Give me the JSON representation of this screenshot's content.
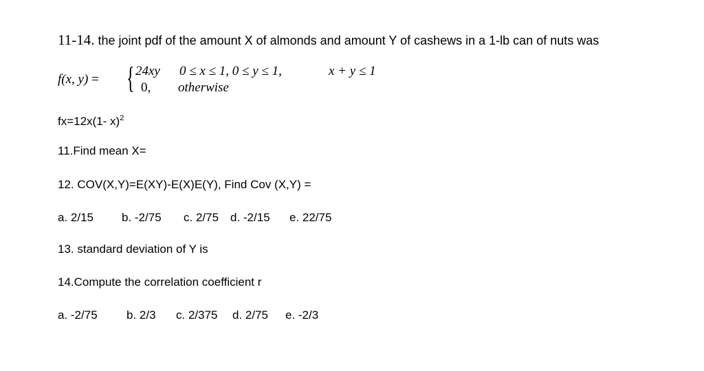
{
  "problem": {
    "number": "11-14.",
    "intro": " the joint pdf of the amount X of almonds and amount Y of cashews in a 1-lb can of nuts was"
  },
  "formula": {
    "lhs": "f(x, y)",
    "equals": " =",
    "brace": "{",
    "case1_expr": "24xy",
    "case1_condition": "0 ≤ x ≤ 1, 0 ≤ y ≤ 1,",
    "case1_extra": "x + y ≤ 1",
    "case2_expr": "0,",
    "case2_condition": "otherwise"
  },
  "marginal": {
    "text": "fx=12x(1- x)",
    "exponent": "2"
  },
  "questions": [
    {
      "id": "q11",
      "text": "11.Find mean X="
    },
    {
      "id": "q12",
      "text": "12. COV(X,Y)=E(XY)-E(X)E(Y), Find Cov (X,Y) ="
    },
    {
      "id": "q13",
      "text": "13. standard deviation of Y is"
    },
    {
      "id": "q14",
      "text": "14.Compute the correlation coefficient r"
    }
  ],
  "options_q12": [
    "a. 2/15",
    "b. -2/75",
    "c. 2/75",
    "d. -2/15",
    "e. 22/75"
  ],
  "options_q14": [
    "a. -2/75",
    "b. 2/3",
    "c. 2/375",
    "d. 2/75",
    "e. -2/3"
  ]
}
